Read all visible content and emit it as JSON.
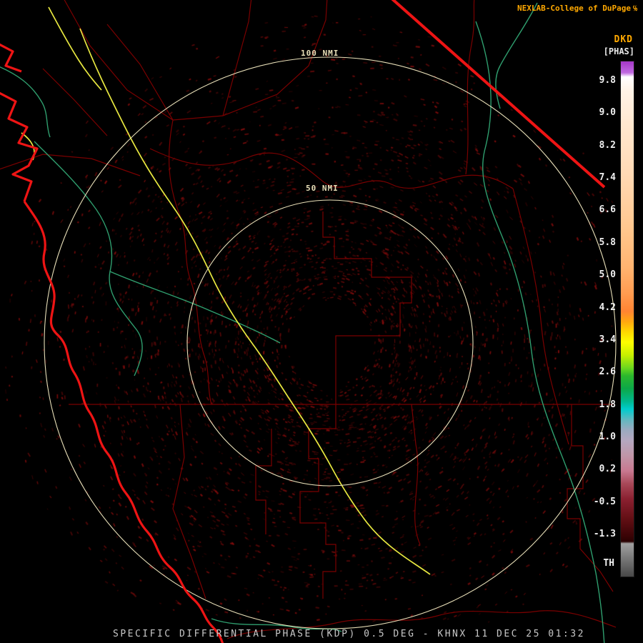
{
  "header": {
    "title": "NEXLAB-College of DuPage",
    "logo_glyph": "℅",
    "product_code": "DKD",
    "units_label": "[PHAS]"
  },
  "colorbar": {
    "tick_labels": [
      "9.8",
      "9.0",
      "8.2",
      "7.4",
      "6.6",
      "5.8",
      "5.0",
      "4.2",
      "3.4",
      "2.6",
      "1.8",
      "1.0",
      "0.2",
      "-0.5",
      "-1.3"
    ],
    "threshold_label": "TH",
    "gradient": [
      {
        "pos": 0,
        "color": "#a437c8"
      },
      {
        "pos": 2.2,
        "color": "#c06ae0"
      },
      {
        "pos": 3.0,
        "color": "#ffffff"
      },
      {
        "pos": 5.5,
        "color": "#fff4e8"
      },
      {
        "pos": 12,
        "color": "#ffe8d0"
      },
      {
        "pos": 22,
        "color": "#ffd9b4"
      },
      {
        "pos": 32,
        "color": "#ffc890"
      },
      {
        "pos": 40,
        "color": "#ffb470"
      },
      {
        "pos": 45,
        "color": "#ff9c50"
      },
      {
        "pos": 48.5,
        "color": "#ff8432"
      },
      {
        "pos": 50.5,
        "color": "#ffa810"
      },
      {
        "pos": 52.5,
        "color": "#ffd800"
      },
      {
        "pos": 54.5,
        "color": "#fdfd00"
      },
      {
        "pos": 57,
        "color": "#c8f000"
      },
      {
        "pos": 59.5,
        "color": "#6cd81e"
      },
      {
        "pos": 61,
        "color": "#2cb82c"
      },
      {
        "pos": 63.5,
        "color": "#0ca848"
      },
      {
        "pos": 66,
        "color": "#00b890"
      },
      {
        "pos": 67.5,
        "color": "#00cccc"
      },
      {
        "pos": 69.5,
        "color": "#60b8c0"
      },
      {
        "pos": 71.5,
        "color": "#9aaac0"
      },
      {
        "pos": 73.5,
        "color": "#b4a8c0"
      },
      {
        "pos": 76.5,
        "color": "#c096a8"
      },
      {
        "pos": 79.5,
        "color": "#c87890"
      },
      {
        "pos": 82,
        "color": "#a84858"
      },
      {
        "pos": 85,
        "color": "#8a2030"
      },
      {
        "pos": 88.5,
        "color": "#661016"
      },
      {
        "pos": 92,
        "color": "#3c0406"
      },
      {
        "pos": 93.2,
        "color": "#2a0202"
      },
      {
        "pos": 93.6,
        "color": "#a0a0a0"
      },
      {
        "pos": 100,
        "color": "#484848"
      }
    ]
  },
  "map": {
    "range_ring_labels": {
      "outer": "100 NMI",
      "inner": "50 NMI"
    }
  },
  "footer": {
    "caption": "SPECIFIC DIFFERENTIAL PHASE (KDP) 0.5 DEG - KHNX 11 DEC 25 01:32"
  },
  "colors": {
    "background": "#000000",
    "state_border": "#ee1414",
    "county_border": "#7a0000",
    "river": "#2f9e6e",
    "highway": "#e8e840",
    "range_ring": "#e8dfb8",
    "title": "#ffa800",
    "product_code": "#ffa800",
    "units": "#e8e8e8",
    "tick_text": "#f0f0f0",
    "caption": "#c8c8c8",
    "speckle": "#8b1010"
  }
}
